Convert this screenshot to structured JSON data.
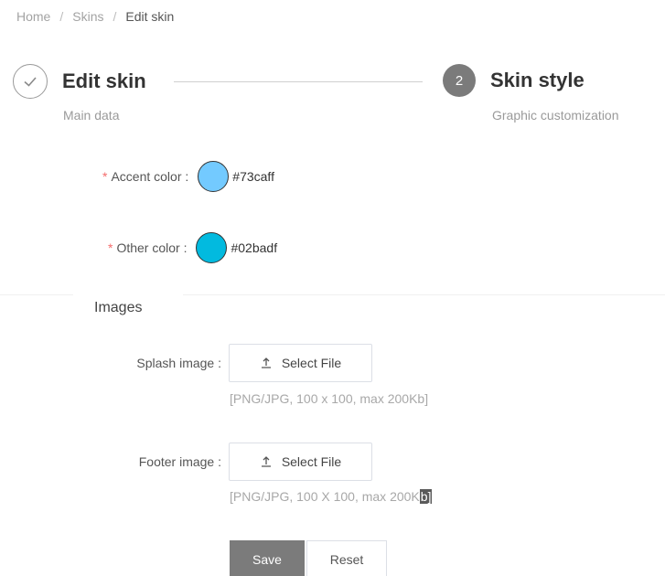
{
  "breadcrumb": {
    "items": [
      "Home",
      "Skins",
      "Edit skin"
    ],
    "separator": "/"
  },
  "steps": [
    {
      "title": "Edit skin",
      "description": "Main data",
      "status": "completed",
      "icon": "check-icon"
    },
    {
      "number": "2",
      "title": "Skin style",
      "description": "Graphic customization",
      "status": "active"
    }
  ],
  "colors": {
    "required_mark": "*",
    "accent": {
      "label": "Accent color :",
      "value": "#73caff",
      "swatch": "#73caff"
    },
    "other": {
      "label": "Other color :",
      "value": "#02badf",
      "swatch": "#02badf"
    }
  },
  "images_section": {
    "title": "Images",
    "splash": {
      "label": "Splash image :",
      "button": "Select File",
      "hint": "[PNG/JPG, 100 x 100, max 200Kb]",
      "icon": "upload-icon"
    },
    "footer": {
      "label": "Footer image :",
      "button": "Select File",
      "hint_prefix": "[PNG/JPG, 100 X 100, max 200K",
      "hint_selected": "b]",
      "icon": "upload-icon"
    }
  },
  "actions": {
    "save": "Save",
    "reset": "Reset"
  },
  "theme": {
    "primary_button": "#7b7b7b",
    "required": "#f56c6c"
  }
}
